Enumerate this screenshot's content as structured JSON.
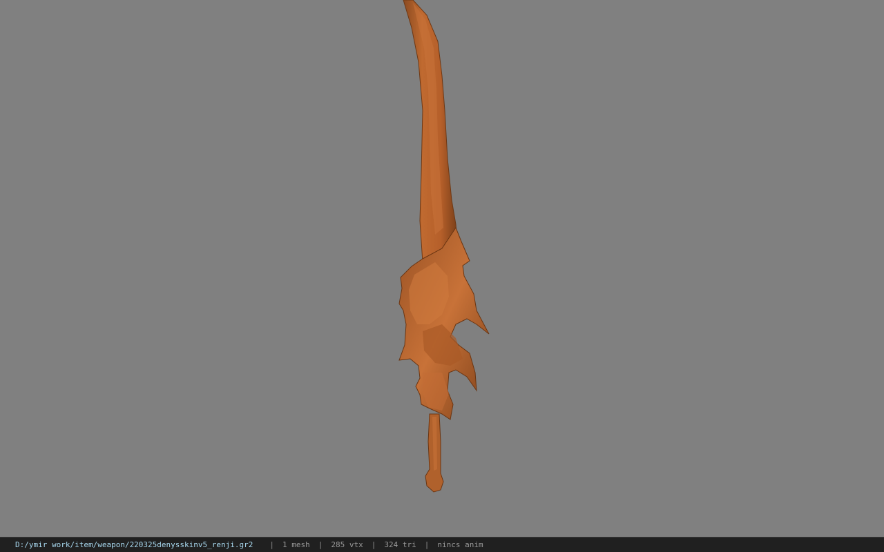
{
  "viewport": {
    "background": "#808080",
    "model_color": "#b8652e"
  },
  "status_bar": {
    "file_path": "D:/ymir work/item/weapon/220325denysskinv5_renji.gr2",
    "separator": "|",
    "mesh": "1 mesh",
    "vertices": "285 vtx",
    "triangles": "324 tri",
    "animation": "nincs anim"
  }
}
